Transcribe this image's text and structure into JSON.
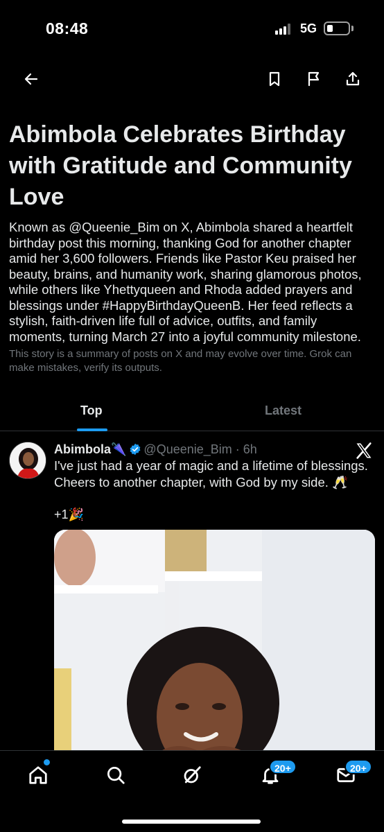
{
  "status_bar": {
    "time": "08:48",
    "network": "5G"
  },
  "story": {
    "title": "Abimbola Celebrates Birthday with Gratitude and Community Love",
    "summary": "Known as @Queenie_Bim on X, Abimbola shared a heartfelt birthday post this morning, thanking God for another chapter amid her 3,600 followers. Friends like Pastor Keu praised her beauty, brains, and humanity work, sharing glamorous photos, while others like Yhettyqueen and Rhoda added prayers and blessings under #HappyBirthdayQueenB. Her feed reflects a stylish, faith-driven life full of advice, outfits, and family moments, turning March 27 into a joyful community milestone.",
    "disclaimer": "This story is a summary of posts on X and may evolve over time. Grok can make mistakes, verify its outputs."
  },
  "tabs": [
    {
      "label": "Top",
      "active": true
    },
    {
      "label": "Latest",
      "active": false
    }
  ],
  "post": {
    "author": "Abimbola🌂",
    "handle": "@Queenie_Bim · 6h",
    "text": "I've just had a year of magic and a lifetime of blessings. Cheers to another chapter, with God by my side. 🥂",
    "extra": "+1🎉"
  },
  "bottom_nav": {
    "notifications_badge": "20+",
    "messages_badge": "20+"
  },
  "colors": {
    "accent": "#1d9bf0",
    "background": "#000000",
    "muted": "#71767b"
  },
  "icons": [
    "back-arrow-icon",
    "bookmark-icon",
    "flag-icon",
    "share-icon",
    "verified-badge-icon",
    "x-logo-icon",
    "home-icon",
    "search-icon",
    "grok-icon",
    "bell-icon",
    "mail-icon"
  ]
}
